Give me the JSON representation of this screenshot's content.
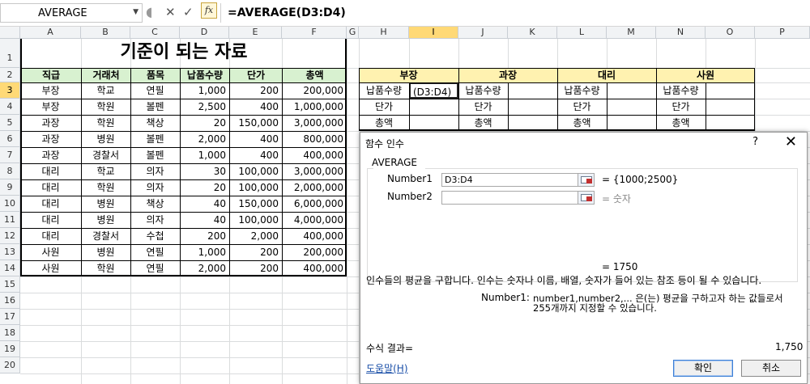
{
  "formula_bar": {
    "name_box": "AVERAGE",
    "cancel_glyph": "✕",
    "enter_glyph": "✓",
    "fx_label": "fx",
    "formula": "=AVERAGE(D3:D4)"
  },
  "columns": [
    "A",
    "B",
    "C",
    "D",
    "E",
    "F",
    "G",
    "H",
    "I",
    "J",
    "K",
    "L",
    "M",
    "N",
    "O",
    "P"
  ],
  "rows": [
    "1",
    "2",
    "3",
    "4",
    "5",
    "6",
    "7",
    "8",
    "9",
    "10",
    "11",
    "12",
    "13",
    "14",
    "15",
    "16",
    "17",
    "18",
    "19",
    "20"
  ],
  "selected_column": "I",
  "selected_row": "3",
  "sheet": {
    "title": "기준이 되는 자료",
    "headers": [
      "직급",
      "거래처",
      "품목",
      "납품수량",
      "단가",
      "총액"
    ],
    "records": [
      [
        "부장",
        "학교",
        "연필",
        "1,000",
        "200",
        "200,000"
      ],
      [
        "부장",
        "학원",
        "볼펜",
        "2,500",
        "400",
        "1,000,000"
      ],
      [
        "과장",
        "학원",
        "책상",
        "20",
        "150,000",
        "3,000,000"
      ],
      [
        "과장",
        "병원",
        "볼펜",
        "2,000",
        "400",
        "800,000"
      ],
      [
        "과장",
        "경찰서",
        "볼펜",
        "1,000",
        "400",
        "400,000"
      ],
      [
        "대리",
        "학교",
        "의자",
        "30",
        "100,000",
        "3,000,000"
      ],
      [
        "대리",
        "학원",
        "의자",
        "20",
        "100,000",
        "2,000,000"
      ],
      [
        "대리",
        "병원",
        "책상",
        "40",
        "150,000",
        "6,000,000"
      ],
      [
        "대리",
        "병원",
        "의자",
        "40",
        "100,000",
        "4,000,000"
      ],
      [
        "대리",
        "경찰서",
        "수첩",
        "200",
        "2,000",
        "400,000"
      ],
      [
        "사원",
        "병원",
        "연필",
        "1,000",
        "200",
        "200,000"
      ],
      [
        "사원",
        "학원",
        "연필",
        "2,000",
        "200",
        "400,000"
      ]
    ]
  },
  "summary": {
    "groups": [
      "부장",
      "과장",
      "대리",
      "사원"
    ],
    "row_labels": [
      "납품수량",
      "단가",
      "총액"
    ],
    "editing_cell": "(D3:D4)"
  },
  "dialog": {
    "title": "함수 인수",
    "help_glyph": "?",
    "close_glyph": "✕",
    "function_name": "AVERAGE",
    "args": [
      {
        "label": "Number1",
        "value": "D3:D4",
        "result": "= {1000;2500}"
      },
      {
        "label": "Number2",
        "value": "",
        "result": "= 숫자"
      }
    ],
    "preview_result": "= 1750",
    "description": "인수들의 평균을 구합니다. 인수는 숫자나 이름, 배열, 숫자가 들어 있는 참조 등이 될 수 있습니다.",
    "arg_help_label": "Number1:",
    "arg_help_line1": "number1,number2,... 은(는) 평균을 구하고자 하는 값들로서",
    "arg_help_line2": "255개까지 지정할 수 있습니다.",
    "formula_result_label": "수식 결과=",
    "formula_result_value": "1,750",
    "help_link": "도움말(H)",
    "ok_label": "확인",
    "cancel_label": "취소"
  }
}
